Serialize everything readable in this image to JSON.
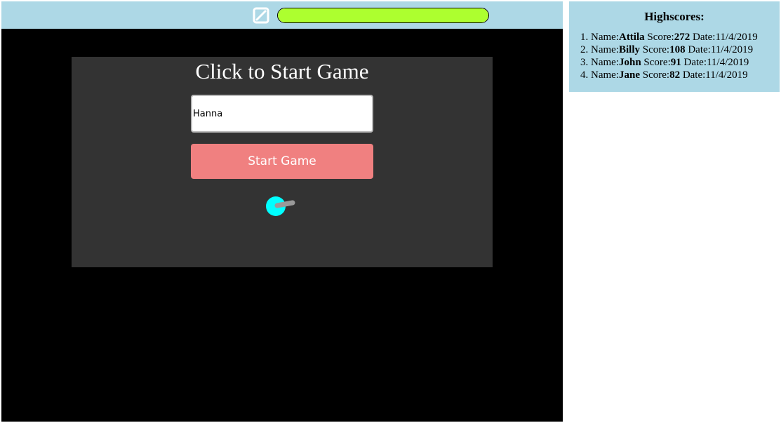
{
  "colors": {
    "top_bar": "#add8e6",
    "health_fill": "#adff2f",
    "panel": "#333333",
    "button": "#f08080",
    "player_body": "#00ffff",
    "player_gun": "#999999",
    "highscore_bg": "#add8e6"
  },
  "top_bar": {
    "mute_icon": "mute-icon",
    "health_level": 1.0
  },
  "menu": {
    "title": "Click to Start Game",
    "name_input_value": "Hanna",
    "start_label": "Start Game"
  },
  "player": {
    "icon": "player-sprite"
  },
  "highscores": {
    "title": "Highscores:",
    "name_prefix": "Name:",
    "score_prefix": "Score:",
    "date_prefix": "Date:",
    "entries": [
      {
        "name": "Attila",
        "score": "272",
        "date": "11/4/2019"
      },
      {
        "name": "Billy",
        "score": "108",
        "date": "11/4/2019"
      },
      {
        "name": "John",
        "score": "91",
        "date": "11/4/2019"
      },
      {
        "name": "Jane",
        "score": "82",
        "date": "11/4/2019"
      }
    ]
  }
}
